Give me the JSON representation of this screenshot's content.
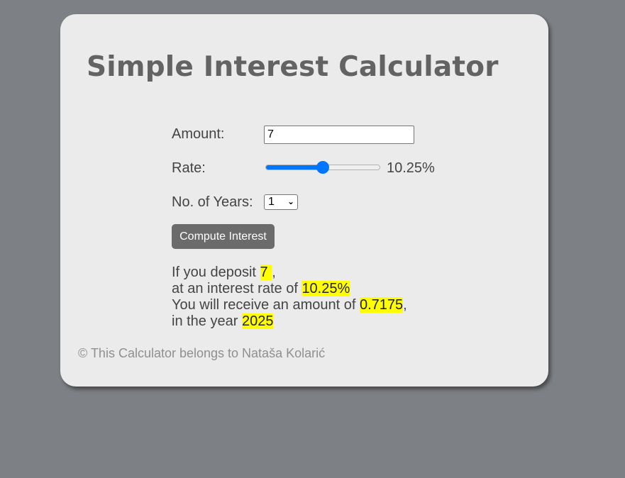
{
  "title": "Simple Interest Calculator",
  "form": {
    "amount_label": "Amount:",
    "amount_value": "7",
    "rate_label": "Rate:",
    "rate_value_text": "10.25%",
    "rate_slider_level": 0.5,
    "years_label": "No. of Years:",
    "years_selected": "1",
    "compute_button_label": "Compute Interest"
  },
  "result": {
    "deposit_prefix": "If you deposit ",
    "deposit_value": "7 ",
    "deposit_suffix": ",",
    "rate_prefix": "at an interest rate of ",
    "rate_value": "10.25%",
    "amount_prefix": "You will receive an amount of ",
    "amount_value": "0.7175",
    "amount_suffix": ",",
    "year_prefix": "in the year ",
    "year_value": "2025"
  },
  "footer": "© This Calculator belongs to Nataša Kolarić",
  "colors": {
    "page_background": "#7d8085",
    "card_background": "#ebebeb",
    "title": "#636363",
    "accent": "#0075ff",
    "button": "#6b6b6b",
    "highlight": "#ffff00"
  },
  "icons": {
    "select_chevron": "chevron-down-icon"
  }
}
